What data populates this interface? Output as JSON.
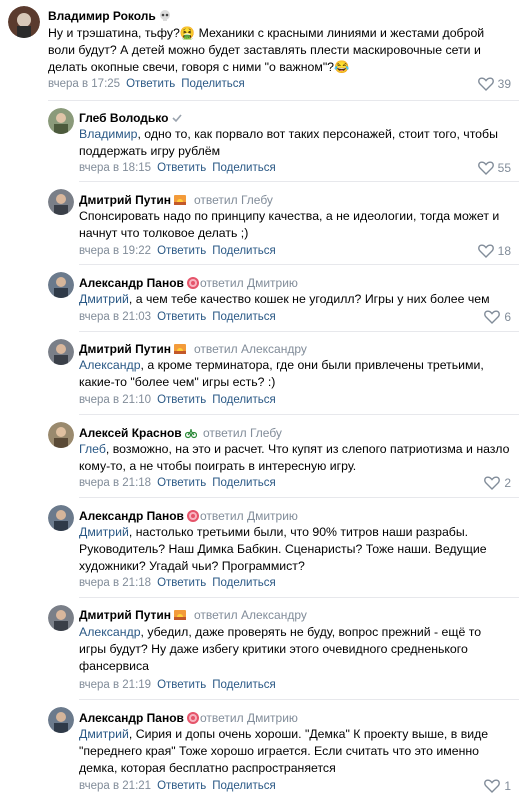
{
  "comments": [
    {
      "author": "Владимир Роколь",
      "author_emoji": "skull-emoji",
      "replied_to": "",
      "mention": "",
      "text": "Ну и трэшатина, тьфу?🤮 Механики с красными линиями и жестами доброй воли будут? А детей можно будет заставлять плести маскировочные сети и делать окопные свечи, говоря с ними \"о важном\"?😂",
      "time": "вчера в 17:25",
      "reply_label": "Ответить",
      "share_label": "Поделиться",
      "likes": "39"
    },
    {
      "author": "Глеб Володько",
      "author_emoji": "check-icon",
      "replied_to": "",
      "mention": "Владимир",
      "text": ", одно то, как порвало вот таких персонажей, стоит того, чтобы поддержать игру рублём",
      "time": "вчера в 18:15",
      "reply_label": "Ответить",
      "share_label": "Поделиться",
      "likes": "55"
    },
    {
      "author": "Дмитрий Путин",
      "author_emoji": "sunset-emoji",
      "replied_to": "ответил Глебу",
      "mention": "",
      "text": "Спонсировать надо по принципу качества, а не идеологии, тогда может и начнут что толковое делать ;)",
      "time": "вчера в 19:22",
      "reply_label": "Ответить",
      "share_label": "Поделиться",
      "likes": "18"
    },
    {
      "author": "Александр Панов",
      "author_emoji": "target-emoji",
      "replied_to": "ответил Дмитрию",
      "mention": "Дмитрий",
      "text": ", а чем тебе качество кошек не угодилл? Игры у них более чем",
      "time": "вчера в 21:03",
      "reply_label": "Ответить",
      "share_label": "Поделиться",
      "likes": "6"
    },
    {
      "author": "Дмитрий Путин",
      "author_emoji": "sunset-emoji",
      "replied_to": "ответил Александру",
      "mention": "Александр",
      "text": ", а кроме терминатора, где они были привлечены третьими, какие-то \"более чем\" игры есть? :)",
      "time": "вчера в 21:10",
      "reply_label": "Ответить",
      "share_label": "Поделиться",
      "likes": ""
    },
    {
      "author": "Алексей Краснов",
      "author_emoji": "bicycle-emoji",
      "replied_to": "ответил Глебу",
      "mention": "Глеб",
      "text": ", возможно, на это и расчет. Что купят из слепого патриотизма и назло кому-то, а не чтобы поиграть в интересную игру.",
      "time": "вчера в 21:18",
      "reply_label": "Ответить",
      "share_label": "Поделиться",
      "likes": "2"
    },
    {
      "author": "Александр Панов",
      "author_emoji": "target-emoji",
      "replied_to": "ответил Дмитрию",
      "mention": "Дмитрий",
      "text": ", настолько третьими были, что 90% титров наши разрабы. Руководитель? Наш Димка Бабкин. Сценаристы? Тоже наши. Ведущие художники? Угадай чьи? Программист?",
      "time": "вчера в 21:18",
      "reply_label": "Ответить",
      "share_label": "Поделиться",
      "likes": ""
    },
    {
      "author": "Дмитрий Путин",
      "author_emoji": "sunset-emoji",
      "replied_to": "ответил Александру",
      "mention": "Александр",
      "text": ", убедил, даже проверять не буду, вопрос прежний - ещё то игры будут? Ну даже избегу критики этого очевидного средненького фансервиса",
      "time": "вчера в 21:19",
      "reply_label": "Ответить",
      "share_label": "Поделиться",
      "likes": ""
    },
    {
      "author": "Александр Панов",
      "author_emoji": "target-emoji",
      "replied_to": "ответил Дмитрию",
      "mention": "Дмитрий",
      "text": ", Сирия и допы очень хороши. \"Демка\" К проекту выше, в виде \"переднего края\" Тоже хорошо играется. Если считать что это именно демка, которая бесплатно распространяется",
      "time": "вчера в 21:21",
      "reply_label": "Ответить",
      "share_label": "Поделиться",
      "likes": "1"
    }
  ],
  "colors": {
    "link": "#2a5885",
    "muted": "#818c99",
    "separator": "#e7e8ec"
  }
}
